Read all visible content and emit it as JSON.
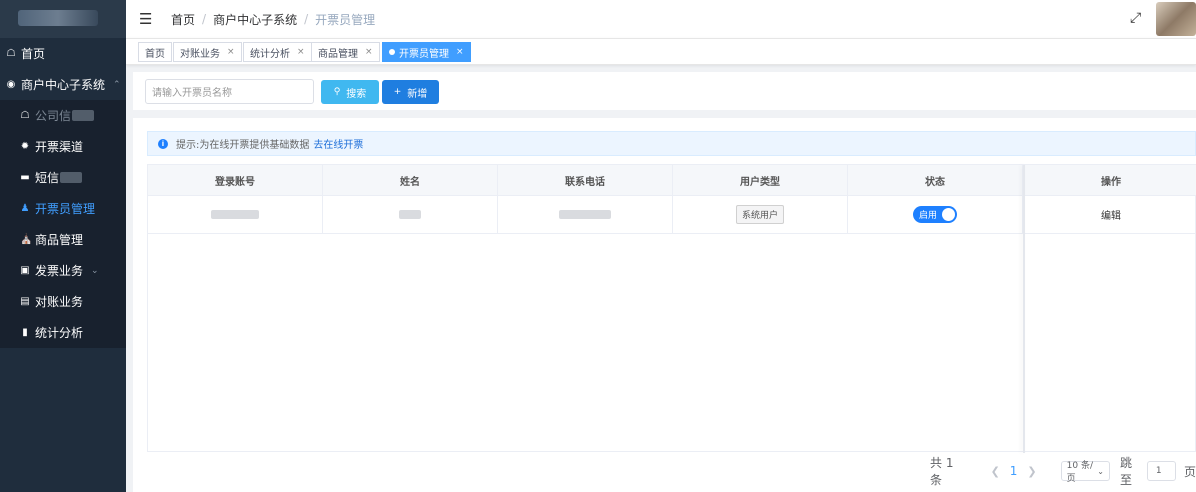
{
  "sidebar": {
    "items": [
      {
        "icon": "home-icon",
        "label": "首页"
      },
      {
        "icon": "system-icon",
        "label": "商户中心子系统",
        "caret": "^"
      }
    ],
    "sub_items": [
      {
        "icon": "home-icon",
        "label": "公司信"
      },
      {
        "icon": "gear-icon",
        "label": "开票渠道"
      },
      {
        "icon": "message-icon",
        "label": "短信"
      },
      {
        "icon": "user-group-icon",
        "label": "开票员管理",
        "active": true
      },
      {
        "icon": "shop-icon",
        "label": "商品管理"
      },
      {
        "icon": "ticket-icon",
        "label": "发票业务",
        "caret": "v"
      },
      {
        "icon": "reconcile-icon",
        "label": "对账业务"
      },
      {
        "icon": "bar-chart-icon",
        "label": "统计分析"
      }
    ]
  },
  "header": {
    "breadcrumb": [
      "首页",
      "商户中心子系统",
      "开票员管理"
    ],
    "separator": "/"
  },
  "tags": [
    {
      "label": "首页",
      "closable": false
    },
    {
      "label": "对账业务",
      "closable": true
    },
    {
      "label": "统计分析",
      "closable": true
    },
    {
      "label": "商品管理",
      "closable": true
    },
    {
      "label": "开票员管理",
      "closable": true,
      "active": true
    }
  ],
  "search": {
    "placeholder": "请输入开票员名称",
    "search_label": "搜索",
    "add_label": "新增"
  },
  "alert": {
    "text": "提示:为在线开票提供基础数据",
    "link": "去在线开票"
  },
  "table": {
    "headers": [
      "登录账号",
      "姓名",
      "联系电话",
      "用户类型",
      "状态",
      "操作"
    ],
    "rows": [
      {
        "account": "",
        "name": "",
        "phone": "",
        "user_type": "系统用户",
        "status": "启用",
        "action": "编辑"
      }
    ]
  },
  "pagination": {
    "total": "共 1 条",
    "current": "1",
    "page_size": "10 条/页",
    "jump_label": "跳至",
    "jump_value": "1",
    "page_suffix": "页"
  },
  "colors": {
    "sidebar_bg": "#1f2d3d",
    "accent": "#409eff",
    "add_button": "#1f7ee0"
  }
}
